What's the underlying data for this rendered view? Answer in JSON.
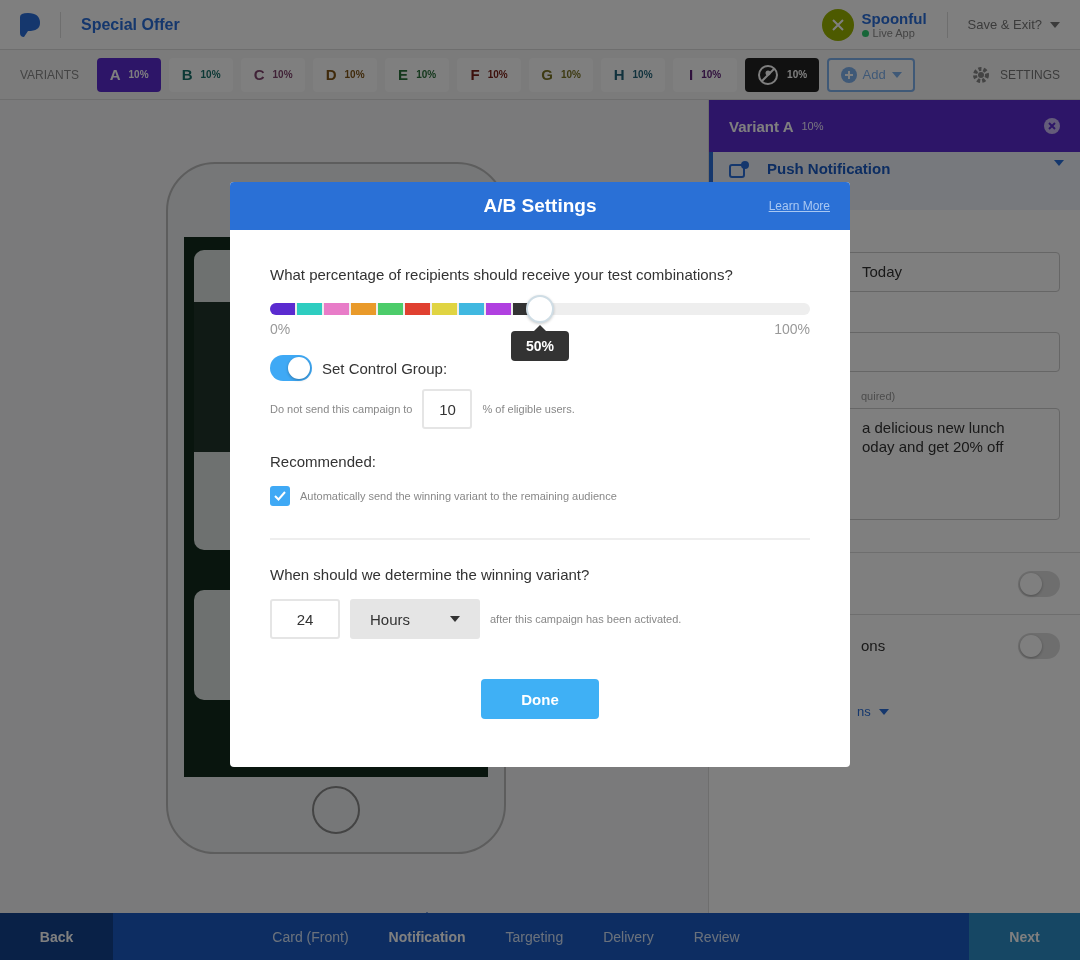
{
  "header": {
    "title": "Special Offer",
    "app_name": "Spoonful",
    "app_status": "Live App",
    "save_menu": "Save & Exit?"
  },
  "variants_bar": {
    "label": "VARIANTS",
    "add": "Add",
    "settings": "SETTINGS"
  },
  "variants": [
    {
      "kind": "variant",
      "letter": "A",
      "share": "10%",
      "selected": true
    },
    {
      "kind": "variant",
      "letter": "B",
      "share": "10%",
      "selected": false
    },
    {
      "kind": "variant",
      "letter": "C",
      "share": "10%",
      "selected": false
    },
    {
      "kind": "variant",
      "letter": "D",
      "share": "10%",
      "selected": false
    },
    {
      "kind": "variant",
      "letter": "E",
      "share": "10%",
      "selected": false
    },
    {
      "kind": "variant",
      "letter": "F",
      "share": "10%",
      "selected": false
    },
    {
      "kind": "variant",
      "letter": "G",
      "share": "10%",
      "selected": false
    },
    {
      "kind": "variant",
      "letter": "H",
      "share": "10%",
      "selected": false
    },
    {
      "kind": "variant",
      "letter": "I",
      "share": "10%",
      "selected": false
    },
    {
      "kind": "control",
      "share": "10%",
      "selected": false
    }
  ],
  "panel": {
    "title": "Variant A",
    "share": "10%",
    "section": "Push Notification",
    "title_value": "Today",
    "hint": "quired)",
    "message_lines": [
      "a delicious new lunch",
      "oday and get 20% off"
    ],
    "toggles": [
      {
        "on": false
      },
      {
        "label": "ons",
        "on": false
      }
    ],
    "more": "ns"
  },
  "modal": {
    "title": "A/B Settings",
    "learn_more": "Learn More",
    "question": "What percentage of recipients should receive your test combinations?",
    "slider": {
      "segments": [
        {
          "color": "#5b2bd0"
        },
        {
          "color": "#2ecdc0"
        },
        {
          "color": "#e87cc8"
        },
        {
          "color": "#e99a2a"
        },
        {
          "color": "#4ccc6a"
        },
        {
          "color": "#e04030"
        },
        {
          "color": "#e0d442"
        },
        {
          "color": "#40b8e0"
        },
        {
          "color": "#b040e0"
        },
        {
          "color": "#333333"
        }
      ],
      "level": 0.5,
      "min_label": "0%",
      "max_label": "100%",
      "tooltip": "50%"
    },
    "control_group": {
      "on": true,
      "label": "Set Control Group:",
      "before": "Do not send this campaign to",
      "value": "10",
      "after": "% of eligible users."
    },
    "recommended": "Recommended:",
    "auto_send": {
      "checked": true,
      "label": "Automatically send the winning variant to the remaining audience"
    },
    "winner_question": "When should we determine the winning variant?",
    "duration": "24",
    "unit": "Hours",
    "duration_after": "after this campaign has been activated.",
    "done": "Done"
  },
  "footer": {
    "back": "Back",
    "next": "Next",
    "steps": [
      {
        "label": "Card (Front)",
        "selected": false
      },
      {
        "label": "Notification",
        "selected": true
      },
      {
        "label": "Targeting",
        "selected": false
      },
      {
        "label": "Delivery",
        "selected": false
      },
      {
        "label": "Review",
        "selected": false
      }
    ]
  }
}
